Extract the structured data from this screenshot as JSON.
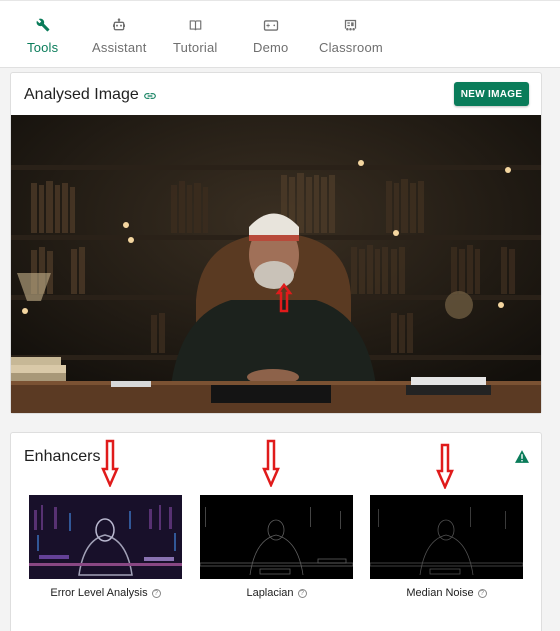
{
  "nav": {
    "tabs": [
      {
        "label": "Tools",
        "icon": "wrench-icon",
        "active": true
      },
      {
        "label": "Assistant",
        "icon": "robot-icon",
        "active": false
      },
      {
        "label": "Tutorial",
        "icon": "book-icon",
        "active": false
      },
      {
        "label": "Demo",
        "icon": "gamepad-icon",
        "active": false
      },
      {
        "label": "Classroom",
        "icon": "classroom-icon",
        "active": false
      }
    ]
  },
  "analysed": {
    "title": "Analysed Image",
    "new_image_label": "NEW IMAGE"
  },
  "enhancers": {
    "title": "Enhancers",
    "items": [
      {
        "label": "Error Level Analysis"
      },
      {
        "label": "Laplacian"
      },
      {
        "label": "Median Noise"
      }
    ]
  },
  "colors": {
    "accent": "#0a7c5a",
    "annotation_arrow": "#e01b1b"
  }
}
